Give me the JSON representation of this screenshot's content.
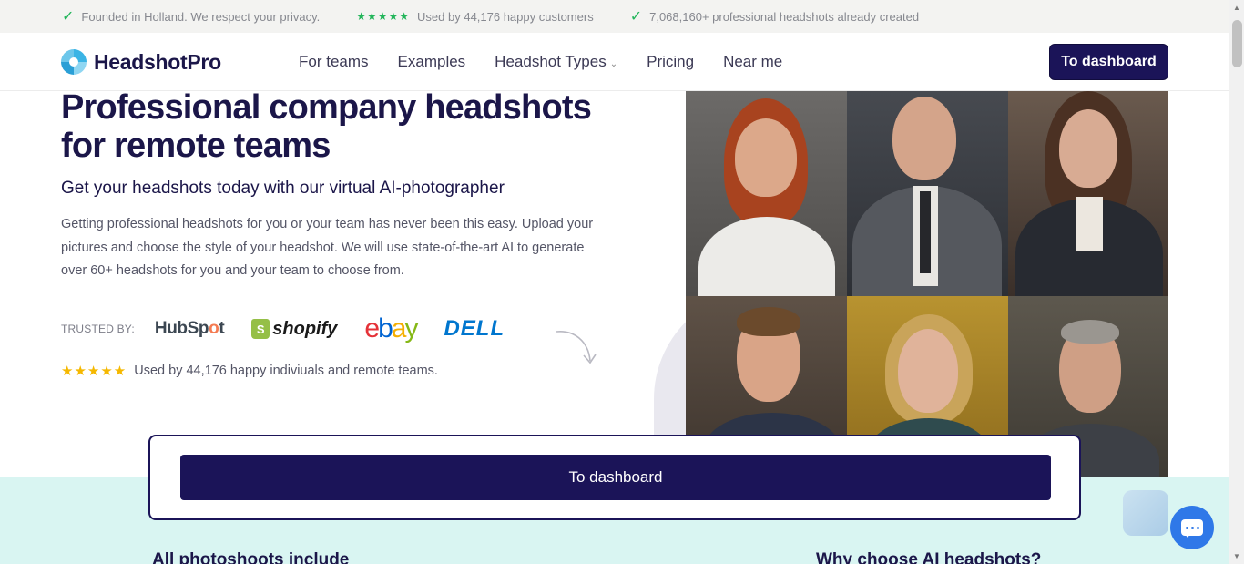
{
  "topbar": {
    "items": [
      {
        "icon": "check-icon",
        "text": "Founded in Holland. We respect your privacy."
      },
      {
        "icon": "stars-icon",
        "stars": "★★★★★",
        "text": "Used by 44,176 happy customers"
      },
      {
        "icon": "check-icon",
        "text": "7,068,160+ professional headshots already created"
      }
    ]
  },
  "nav": {
    "logo_text": "HeadshotPro",
    "links": [
      "For teams",
      "Examples",
      "Headshot Types",
      "Pricing",
      "Near me"
    ],
    "dashboard_label": "To dashboard"
  },
  "hero": {
    "title_line1": "Professional company headshots",
    "title_line2": "for remote teams",
    "subtitle": "Get your headshots today with our virtual AI-photographer",
    "description": "Getting professional headshots for you or your team has never been this easy. Upload your pictures and choose the style of your headshot. We will use state-of-the-art AI to generate over 60+ headshots for you and your team to choose from.",
    "trusted_label": "TRUSTED BY:",
    "brands": [
      "HubSpot",
      "shopify",
      "ebay",
      "DELL"
    ],
    "rating_stars": "★★★★★",
    "rating_text": "Used by 44,176 happy indiviuals and remote teams."
  },
  "cta": {
    "dashboard_label": "To dashboard"
  },
  "bottom": {
    "left_heading": "All photoshoots include",
    "right_heading": "Why choose AI headshots?"
  },
  "colors": {
    "brand_navy": "#1b1458",
    "check_green": "#22b55a",
    "star_yellow": "#f5b800",
    "band_mint": "#d9f5f2",
    "chat_blue": "#2f78e8"
  }
}
